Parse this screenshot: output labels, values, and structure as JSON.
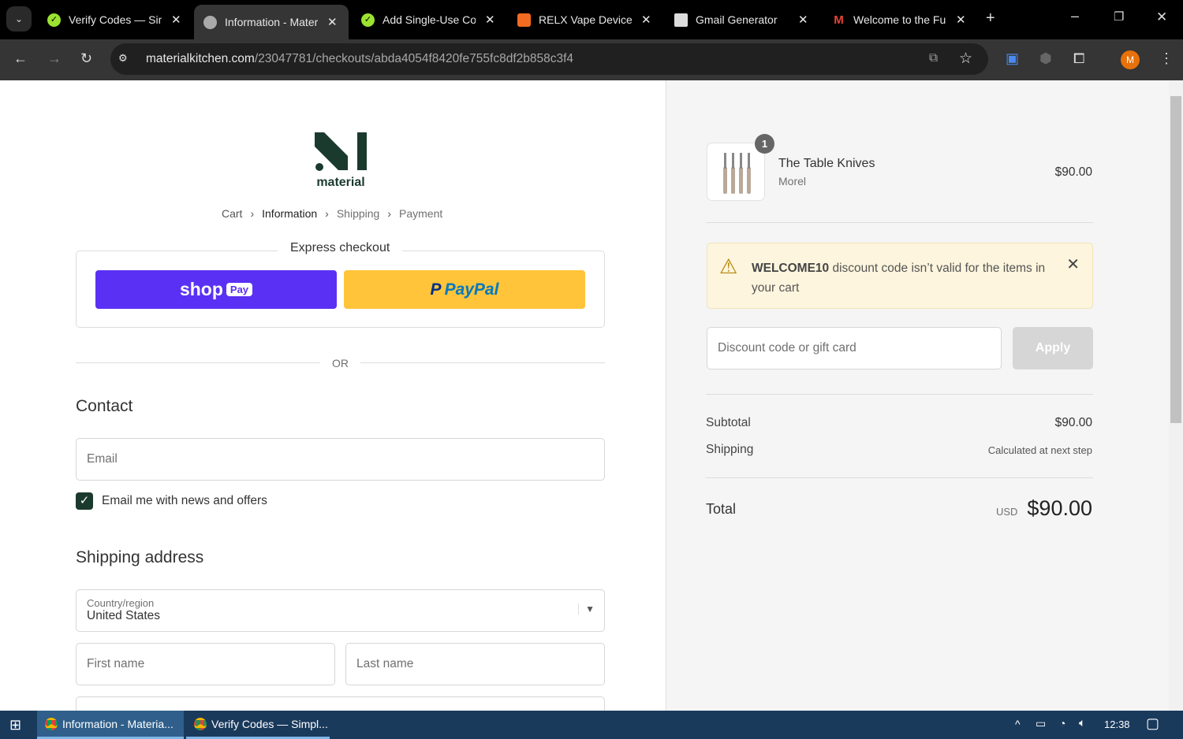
{
  "browser": {
    "tabs": [
      {
        "title": "Verify Codes — Simpl…",
        "favicon": "check-circle-green",
        "active": false
      },
      {
        "title": "Information - Materia…",
        "favicon": "globe",
        "active": true
      },
      {
        "title": "Add Single-Use Codes…",
        "favicon": "check-circle-green",
        "active": false
      },
      {
        "title": "RELX Vape Device…",
        "favicon": "relx-orange",
        "active": false
      },
      {
        "title": "Gmail Generator",
        "favicon": "gmail-generator",
        "active": false
      },
      {
        "title": "Welcome to the Fu…",
        "favicon": "gmail-m",
        "active": false
      }
    ],
    "url_host": "materialkitchen.com",
    "url_path": "/23047781/checkouts/abda4054f8420fe755fc8df2b858c3f4",
    "profile_initial": "M"
  },
  "checkout": {
    "logo_text": "material",
    "breadcrumb": [
      "Cart",
      "Information",
      "Shipping",
      "Payment"
    ],
    "express_title": "Express checkout",
    "shop_label": "shop",
    "shop_pay": "Pay",
    "paypal_p": "P",
    "paypal_label": "PayPal",
    "or": "OR",
    "contact_title": "Contact",
    "email_placeholder": "Email",
    "newsletter_label": "Email me with news and offers",
    "newsletter_checked": true,
    "shipping_title": "Shipping address",
    "country_label": "Country/region",
    "country_value": "United States",
    "first_name_placeholder": "First name",
    "last_name_placeholder": "Last name"
  },
  "summary": {
    "item": {
      "name": "The Table Knives",
      "variant": "Morel",
      "price": "$90.00",
      "quantity": "1"
    },
    "warning": {
      "code": "WELCOME10",
      "message": " discount code isn’t valid for the items in your cart"
    },
    "discount_placeholder": "Discount code or gift card",
    "apply_label": "Apply",
    "subtotal_label": "Subtotal",
    "subtotal": "$90.00",
    "shipping_label": "Shipping",
    "shipping_value": "Calculated at next step",
    "total_label": "Total",
    "currency": "USD",
    "total": "$90.00"
  },
  "taskbar": {
    "items": [
      "Information - Materia...",
      "Verify Codes — Simpl..."
    ],
    "time": "12:38"
  }
}
